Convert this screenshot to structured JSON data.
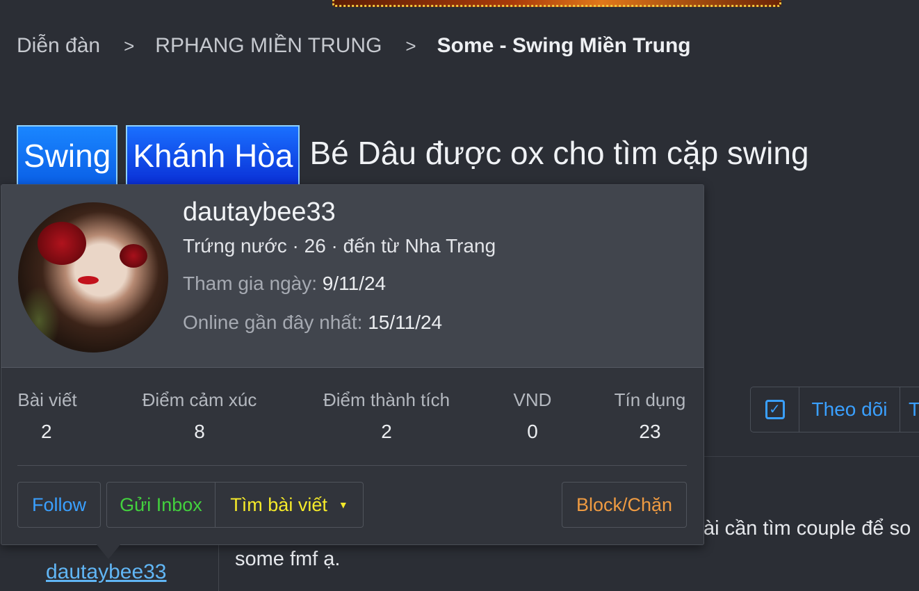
{
  "breadcrumb": {
    "items": [
      "Diễn đàn",
      "RPHANG MIỀN TRUNG"
    ],
    "current": "Some - Swing Miền Trung",
    "separator": ">"
  },
  "thread": {
    "prefixes": [
      "Swing",
      "Khánh Hòa"
    ],
    "title": "Bé Dâu được ox cho tìm cặp swing"
  },
  "thread_actions": {
    "check_icon": "✓",
    "follow_label": "Theo dõi",
    "more_label": "T"
  },
  "member_card": {
    "username": "dautaybee33",
    "user_title": "Trứng nước · 26 · đến từ Nha Trang",
    "joined_label": "Tham gia ngày:",
    "joined_value": "9/11/24",
    "last_seen_label": "Online gần đây nhất:",
    "last_seen_value": "15/11/24",
    "stats": [
      {
        "label": "Bài viết",
        "value": "2"
      },
      {
        "label": "Điểm cảm xúc",
        "value": "8"
      },
      {
        "label": "Điểm thành tích",
        "value": "2"
      },
      {
        "label": "VND",
        "value": "0"
      },
      {
        "label": "Tín dụng",
        "value": "23"
      }
    ],
    "buttons": {
      "follow": "Follow",
      "inbox": "Gửi Inbox",
      "find_posts": "Tìm bài viết",
      "block": "Block/Chặn"
    }
  },
  "post": {
    "text_line1_partial": "ài cần tìm couple để so",
    "text_line2": "some fmf ạ.",
    "author_link": "dautaybee33"
  }
}
